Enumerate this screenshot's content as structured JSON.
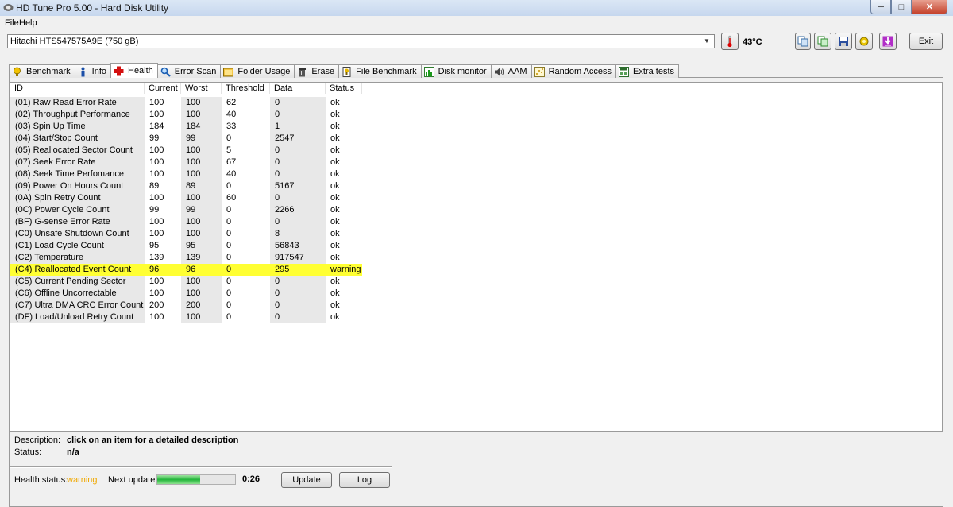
{
  "window": {
    "title": "HD Tune Pro 5.00 - Hard Disk Utility"
  },
  "menu": {
    "file": "File",
    "help": "Help"
  },
  "toolbar": {
    "drive": "Hitachi HTS547575A9E    (750 gB)",
    "temperature": "43°C",
    "exit_label": "Exit",
    "icons": [
      "copy-icon",
      "copy-text-icon",
      "save-icon",
      "options-icon",
      "download-icon"
    ]
  },
  "tabs": [
    {
      "label": "Benchmark",
      "icon": "benchmark-icon"
    },
    {
      "label": "Info",
      "icon": "info-icon"
    },
    {
      "label": "Health",
      "icon": "health-icon",
      "active": true
    },
    {
      "label": "Error Scan",
      "icon": "error-scan-icon"
    },
    {
      "label": "Folder Usage",
      "icon": "folder-icon"
    },
    {
      "label": "Erase",
      "icon": "erase-icon"
    },
    {
      "label": "File Benchmark",
      "icon": "file-benchmark-icon"
    },
    {
      "label": "Disk monitor",
      "icon": "disk-monitor-icon"
    },
    {
      "label": "AAM",
      "icon": "speaker-icon"
    },
    {
      "label": "Random Access",
      "icon": "random-access-icon"
    },
    {
      "label": "Extra tests",
      "icon": "extra-tests-icon"
    }
  ],
  "columns": [
    "ID",
    "Current",
    "Worst",
    "Threshold",
    "Data",
    "Status"
  ],
  "rows": [
    {
      "id": "(01) Raw Read Error Rate",
      "current": "100",
      "worst": "100",
      "threshold": "62",
      "data": "0",
      "status": "ok"
    },
    {
      "id": "(02) Throughput Performance",
      "current": "100",
      "worst": "100",
      "threshold": "40",
      "data": "0",
      "status": "ok"
    },
    {
      "id": "(03) Spin Up Time",
      "current": "184",
      "worst": "184",
      "threshold": "33",
      "data": "1",
      "status": "ok"
    },
    {
      "id": "(04) Start/Stop Count",
      "current": "99",
      "worst": "99",
      "threshold": "0",
      "data": "2547",
      "status": "ok"
    },
    {
      "id": "(05) Reallocated Sector Count",
      "current": "100",
      "worst": "100",
      "threshold": "5",
      "data": "0",
      "status": "ok"
    },
    {
      "id": "(07) Seek Error Rate",
      "current": "100",
      "worst": "100",
      "threshold": "67",
      "data": "0",
      "status": "ok"
    },
    {
      "id": "(08) Seek Time Perfomance",
      "current": "100",
      "worst": "100",
      "threshold": "40",
      "data": "0",
      "status": "ok"
    },
    {
      "id": "(09) Power On Hours Count",
      "current": "89",
      "worst": "89",
      "threshold": "0",
      "data": "5167",
      "status": "ok"
    },
    {
      "id": "(0A) Spin Retry Count",
      "current": "100",
      "worst": "100",
      "threshold": "60",
      "data": "0",
      "status": "ok"
    },
    {
      "id": "(0C) Power Cycle Count",
      "current": "99",
      "worst": "99",
      "threshold": "0",
      "data": "2266",
      "status": "ok"
    },
    {
      "id": "(BF) G-sense Error Rate",
      "current": "100",
      "worst": "100",
      "threshold": "0",
      "data": "0",
      "status": "ok"
    },
    {
      "id": "(C0) Unsafe Shutdown Count",
      "current": "100",
      "worst": "100",
      "threshold": "0",
      "data": "8",
      "status": "ok"
    },
    {
      "id": "(C1) Load Cycle Count",
      "current": "95",
      "worst": "95",
      "threshold": "0",
      "data": "56843",
      "status": "ok"
    },
    {
      "id": "(C2) Temperature",
      "current": "139",
      "worst": "139",
      "threshold": "0",
      "data": "917547",
      "status": "ok"
    },
    {
      "id": "(C4) Reallocated Event Count",
      "current": "96",
      "worst": "96",
      "threshold": "0",
      "data": "295",
      "status": "warning",
      "highlight": true
    },
    {
      "id": "(C5) Current Pending Sector",
      "current": "100",
      "worst": "100",
      "threshold": "0",
      "data": "0",
      "status": "ok"
    },
    {
      "id": "(C6) Offline Uncorrectable",
      "current": "100",
      "worst": "100",
      "threshold": "0",
      "data": "0",
      "status": "ok"
    },
    {
      "id": "(C7) Ultra DMA CRC Error Count",
      "current": "200",
      "worst": "200",
      "threshold": "0",
      "data": "0",
      "status": "ok"
    },
    {
      "id": "(DF) Load/Unload Retry Count",
      "current": "100",
      "worst": "100",
      "threshold": "0",
      "data": "0",
      "status": "ok"
    }
  ],
  "details": {
    "description_label": "Description:",
    "description_value": "click on an item for a detailed description",
    "status_label": "Status:",
    "status_value": "n/a"
  },
  "footer": {
    "health_label": "Health status:",
    "health_value": "warning",
    "health_color": "#f0a800",
    "next_update_label": "Next update:",
    "progress_fraction": 0.55,
    "timer": "0:26",
    "update_label": "Update",
    "log_label": "Log"
  }
}
